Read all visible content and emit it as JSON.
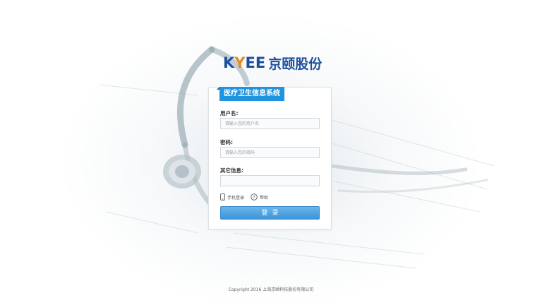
{
  "brand": {
    "mark_prefix": "K",
    "mark_y": "Y",
    "mark_suffix": "EE",
    "name_cn": "京颐股份"
  },
  "panel": {
    "title": "医疗卫生信息系统",
    "username": {
      "label": "用户名:",
      "placeholder": "请输入您的用户名",
      "value": ""
    },
    "password": {
      "label": "密码:",
      "placeholder": "请输入您的密码",
      "value": ""
    },
    "other_info": {
      "label": "其它信息:",
      "value": ""
    },
    "options": {
      "mobile_login": "手机登录",
      "help": "帮助"
    },
    "login_button": "登录"
  },
  "footer": {
    "copyright": "Copyright 2016 上海京颐科技股份有限公司"
  },
  "colors": {
    "brand_blue": "#1d4f9c",
    "brand_orange": "#e8891f",
    "ribbon": "#1f94e0",
    "button": "#4a9fe0"
  },
  "icons": {
    "mobile": "mobile-phone-icon",
    "help": "question-circle-icon"
  }
}
